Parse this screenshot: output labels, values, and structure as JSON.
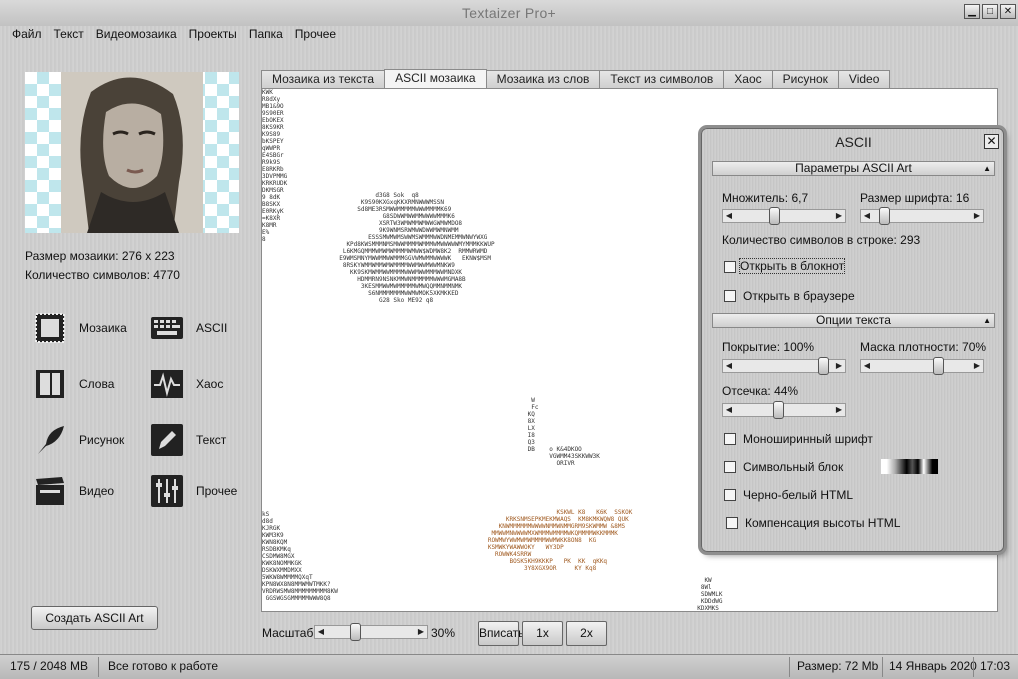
{
  "app": {
    "title": "Textaizer Pro+"
  },
  "menu": [
    "Файл",
    "Текст",
    "Видеомозаика",
    "Проекты",
    "Папка",
    "Прочее"
  ],
  "info": {
    "size_line": "Размер мозаики: 276 x 223",
    "count_line": "Количество символов: 4770"
  },
  "tools": {
    "mosaic": "Мозаика",
    "ascii": "ASCII",
    "words": "Слова",
    "chaos": "Хаос",
    "drawing": "Рисунок",
    "text": "Текст",
    "video": "Видео",
    "other": "Прочее"
  },
  "create_button": "Создать ASCII Art",
  "tabs": [
    "Мозаика из текста",
    "ASCII мозаика",
    "Мозаика из слов",
    "Текст из символов",
    "Хаос",
    "Рисунок",
    "Video"
  ],
  "active_tab": 1,
  "zoom": {
    "label": "Масштаб",
    "value": "30%",
    "level": 0.3,
    "fit": "Вписать",
    "x1": "1x",
    "x2": "2x"
  },
  "status": {
    "memory": "175 / 2048 MB",
    "message": "Все готово к работе",
    "size": "Размер:  72 Mb",
    "date": "14 Январь 2020",
    "time": "17:03"
  },
  "panel": {
    "title": "ASCII",
    "section1": "Параметры ASCII Art",
    "multiplier": "Множитель: 6,7",
    "font_size": "Размер шрифта: 16",
    "chars_per_line": "Количество символов в строке: 293",
    "open_notepad": "Открыть в блокнот",
    "open_browser": "Открыть в браузере",
    "section2": "Опции текста",
    "coverage": "Покрытие: 100%",
    "density_mask": "Маска плотности: 70%",
    "cutoff": "Отсечка: 44%",
    "mono_font": "Моноширинный шрифт",
    "symbol_block": "Символьный блок",
    "bw_html": "Черно-белый HTML",
    "height_comp": "Компенсация высоты HTML"
  },
  "colors": {
    "accent_orange": "#a05a20",
    "panel_bg": "#cbcbcb"
  }
}
